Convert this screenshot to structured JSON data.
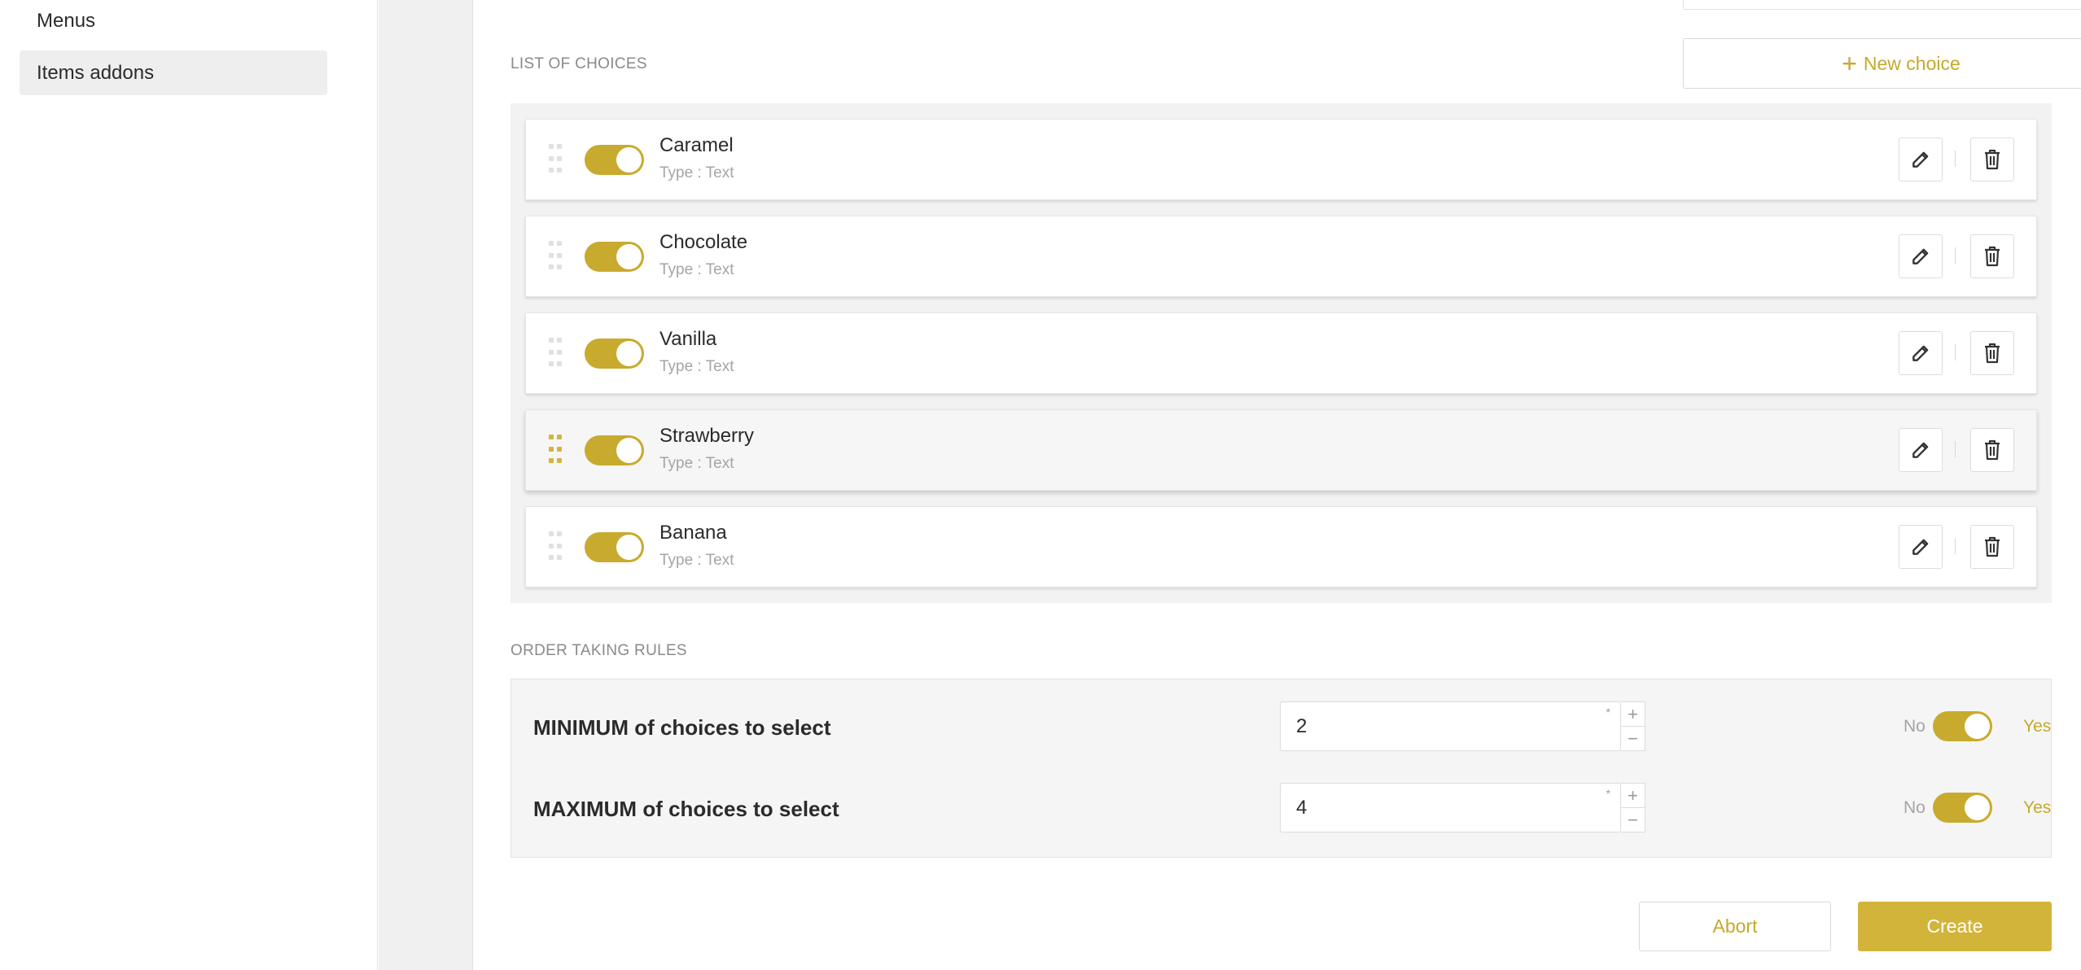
{
  "sidebar": {
    "items": [
      {
        "label": "Menus",
        "active": false
      },
      {
        "label": "Items addons",
        "active": true
      }
    ]
  },
  "choices_section": {
    "label": "LIST OF CHOICES",
    "new_choice_label": "New choice",
    "items": [
      {
        "name": "Caramel",
        "type": "Type : Text",
        "enabled": true
      },
      {
        "name": "Chocolate",
        "type": "Type : Text",
        "enabled": true
      },
      {
        "name": "Vanilla",
        "type": "Type : Text",
        "enabled": true
      },
      {
        "name": "Strawberry",
        "type": "Type : Text",
        "enabled": true,
        "highlighted": true
      },
      {
        "name": "Banana",
        "type": "Type : Text",
        "enabled": true
      }
    ]
  },
  "rules_section": {
    "label": "ORDER TAKING RULES",
    "rules": [
      {
        "label": "MINIMUM of choices to select",
        "value": "2",
        "required_mark": "*",
        "no_label": "No",
        "yes_label": "Yes",
        "enabled": true
      },
      {
        "label": "MAXIMUM of choices to select",
        "value": "4",
        "required_mark": "*",
        "no_label": "No",
        "yes_label": "Yes",
        "enabled": true
      }
    ],
    "stepper": {
      "plus": "+",
      "minus": "−"
    }
  },
  "footer": {
    "abort_label": "Abort",
    "create_label": "Create"
  },
  "icons": {
    "new_choice": "plus-icon",
    "drag": "drag-handle-icon",
    "edit": "pencil-icon",
    "delete": "trash-icon"
  },
  "colors": {
    "accent": "#c8aa2e",
    "create_button": "#d3b43b",
    "panel_bg": "#f2f2f2"
  }
}
